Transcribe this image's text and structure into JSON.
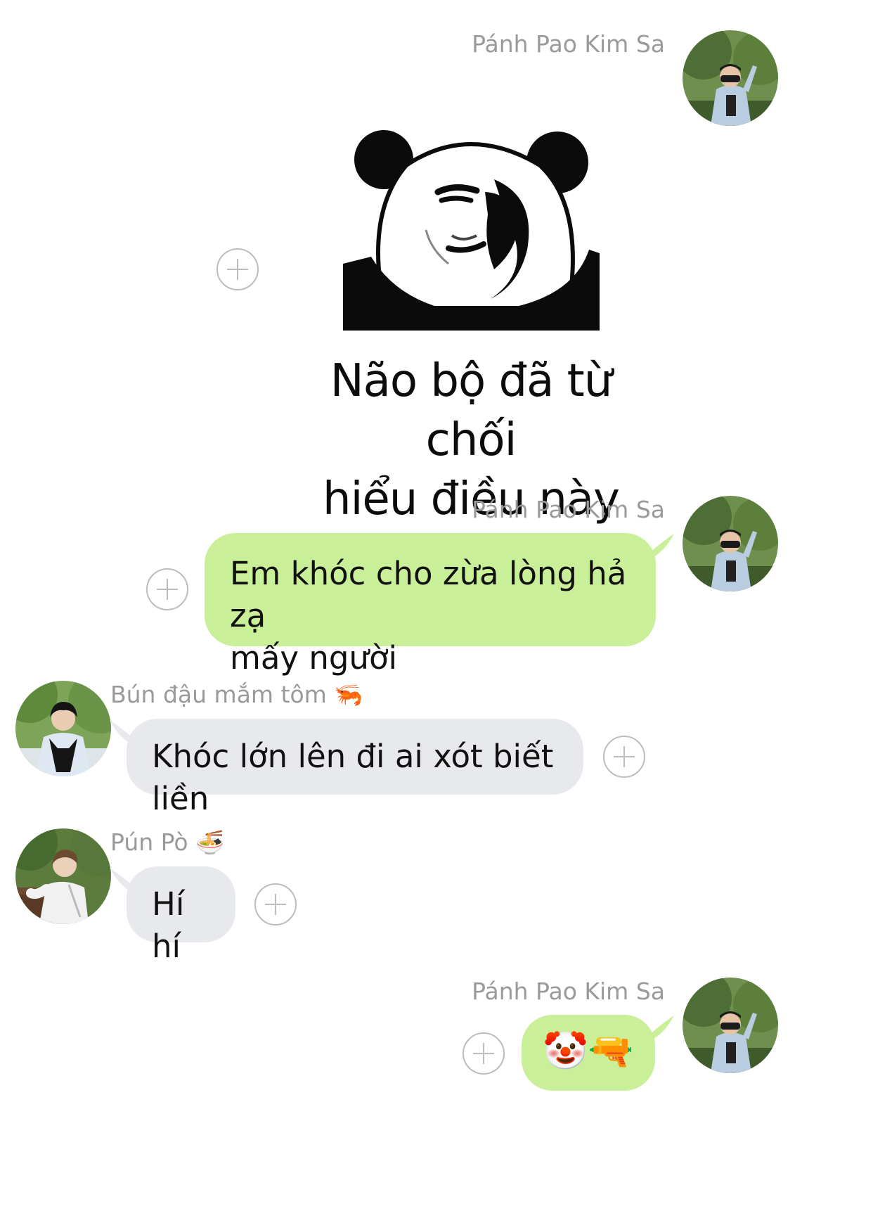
{
  "messages": [
    {
      "sender": "Pánh Pao Kim Sa",
      "direction": "outgoing",
      "type": "sticker",
      "sticker": {
        "icon": "panda-meme-icon",
        "caption_line1": "Não bộ đã từ chối",
        "caption_line2": "hiểu điều này"
      }
    },
    {
      "sender": "Pánh Pao Kim Sa",
      "direction": "outgoing",
      "type": "text",
      "line1": "Em khóc cho zừa lòng hả zạ",
      "line2": "mấy người"
    },
    {
      "sender": "Bún đậu mắm tôm 🦐",
      "direction": "incoming",
      "type": "text",
      "text": "Khóc lớn lên đi ai xót biết liền"
    },
    {
      "sender": "Pún Pò 🍜",
      "direction": "incoming",
      "type": "text",
      "text": "Hí hí"
    },
    {
      "sender": "Pánh Pao Kim Sa",
      "direction": "outgoing",
      "type": "emoji",
      "text": "🤡🔫"
    }
  ],
  "colors": {
    "outgoing_bubble": "#c9ef98",
    "incoming_bubble": "#e8e9ec",
    "sender_name": "#9a9a9a",
    "add_icon": "#bdbdbd"
  },
  "icons": [
    "add-reaction-icon",
    "avatar-icon"
  ]
}
